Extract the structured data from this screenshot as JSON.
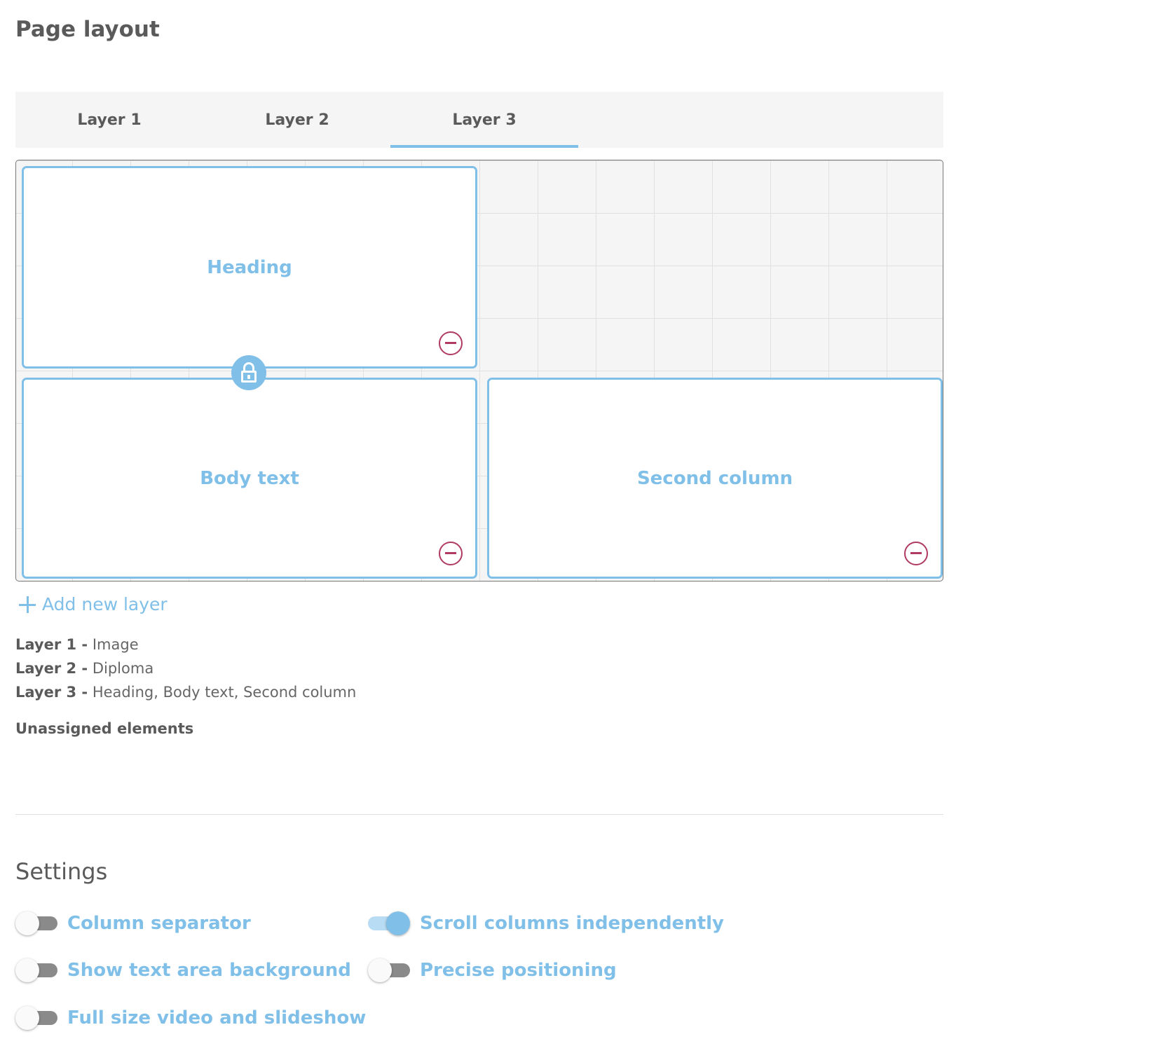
{
  "page": {
    "title": "Page layout"
  },
  "tabs": [
    {
      "label": "Layer 1",
      "active": false
    },
    {
      "label": "Layer 2",
      "active": false
    },
    {
      "label": "Layer 3",
      "active": true
    }
  ],
  "canvas": {
    "blocks": [
      {
        "label": "Heading"
      },
      {
        "label": "Body text"
      },
      {
        "label": "Second column"
      }
    ]
  },
  "add_layer": {
    "label": "Add new layer"
  },
  "summary": [
    {
      "key": "Layer 1 -",
      "value": "Image"
    },
    {
      "key": "Layer 2 -",
      "value": "Diploma"
    },
    {
      "key": "Layer 3 -",
      "value": "Heading, Body text, Second column"
    }
  ],
  "unassigned": {
    "title": "Unassigned elements"
  },
  "settings": {
    "title": "Settings",
    "items": [
      {
        "label": "Column separator",
        "on": false
      },
      {
        "label": "Scroll columns independently",
        "on": true
      },
      {
        "label": "Show text area background",
        "on": false
      },
      {
        "label": "Precise positioning",
        "on": false
      },
      {
        "label": "Full size video and slideshow",
        "on": false
      }
    ]
  },
  "colors": {
    "accent": "#7fbfe8",
    "remove": "#b03a62",
    "text": "#5a5a5a",
    "tab_bg": "#f5f5f5"
  },
  "icons": {
    "remove": "minus-circle-icon",
    "lock": "lock-icon",
    "add": "plus-icon"
  }
}
